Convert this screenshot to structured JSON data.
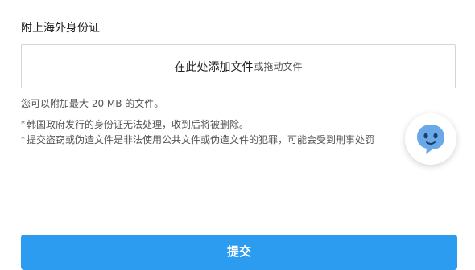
{
  "upload_section": {
    "title": "附上海外身份证",
    "dropzone": {
      "add_label": "在此处添加文件",
      "drag_label": "或拖动文件"
    },
    "size_limit": "您可以附加最大 20 MB 的文件。",
    "notices": [
      "韩国政府发行的身份证无法处理，收到后将被删除。",
      "提交盗窃或伪造文件是非法使用公共文件或伪造文件的犯罪，可能会受到刑事处罚"
    ],
    "notice_marker": "*"
  },
  "chat_widget": {
    "icon": "chatbot-face-icon",
    "color": "#6aa9e8"
  },
  "actions": {
    "submit_label": "提交",
    "submit_color": "#2c9cf0"
  }
}
